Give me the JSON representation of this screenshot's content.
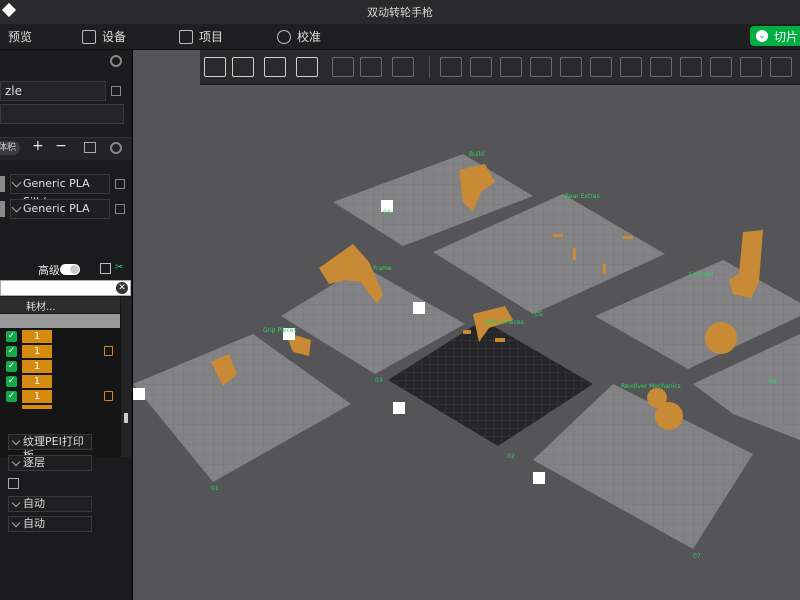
{
  "window": {
    "title": "双动转轮手枪"
  },
  "menubar": {
    "preview": "预览",
    "device": "设备",
    "project": "项目",
    "calibration": "校准",
    "slice": "切片"
  },
  "sidebar": {
    "printer_field": "zle",
    "plate_pill": "体积",
    "filaments": [
      "Generic PLA Silk(...",
      "Generic PLA"
    ],
    "advanced_label": "高级",
    "objects_header": "耗材...",
    "objects": [
      {
        "filament": "1",
        "locked": false
      },
      {
        "filament": "1",
        "locked": true
      },
      {
        "filament": "1",
        "locked": false
      },
      {
        "filament": "1",
        "locked": false
      },
      {
        "filament": "1",
        "locked": true
      }
    ],
    "plate_type": "纹理PEI打印板",
    "layer_mode": "逐层",
    "auto_1": "自动",
    "auto_2": "自动"
  },
  "viewport": {
    "background": "#555557",
    "accent": "#00ae42",
    "plates": [
      {
        "label": "Build",
        "num": "04"
      },
      {
        "label": "Rear Extras",
        "num": "05"
      },
      {
        "label": "Cylinder",
        "num": "06"
      },
      {
        "label": "Frame",
        "num": "03"
      },
      {
        "label": "Bits & Pieces",
        "num": "02"
      },
      {
        "label": "Revolver Mechanics",
        "num": "07"
      },
      {
        "label": "Grip Pieces",
        "num": "01"
      },
      {
        "label": "Cylinder Parts",
        "num": "08"
      }
    ]
  },
  "colors": {
    "filament": "#c88a34",
    "badge_orange": "#d68a10",
    "check_green": "#14a84a"
  }
}
